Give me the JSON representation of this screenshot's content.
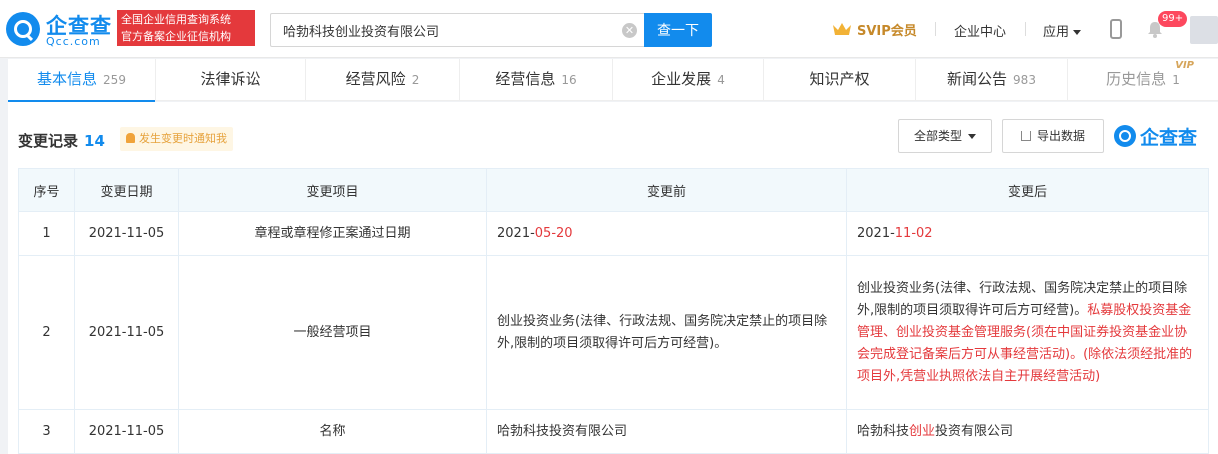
{
  "header": {
    "logo_cn": "企查查",
    "logo_en": "Qcc.com",
    "slogan_line1": "全国企业信用查询系统",
    "slogan_line2": "官方备案企业征信机构",
    "search_value": "哈勃科技创业投资有限公司",
    "search_button": "查一下",
    "svip_label": "SVIP会员",
    "enterprise_center": "企业中心",
    "apps_label": "应用",
    "notification_badge": "99+"
  },
  "tabs": [
    {
      "label": "基本信息",
      "count": "259"
    },
    {
      "label": "法律诉讼",
      "count": ""
    },
    {
      "label": "经营风险",
      "count": "2"
    },
    {
      "label": "经营信息",
      "count": "16"
    },
    {
      "label": "企业发展",
      "count": "4"
    },
    {
      "label": "知识产权",
      "count": ""
    },
    {
      "label": "新闻公告",
      "count": "983"
    },
    {
      "label": "历史信息",
      "count": "1",
      "tag": "VIP"
    }
  ],
  "section": {
    "title": "变更记录",
    "count": "14",
    "notify_label": "发生变更时通知我",
    "filter_label": "全部类型",
    "export_label": "导出数据",
    "brand_label": "企查查"
  },
  "table": {
    "headers": [
      "序号",
      "变更日期",
      "变更项目",
      "变更前",
      "变更后"
    ],
    "rows": [
      {
        "index": "1",
        "date": "2021-11-05",
        "item": "章程或章程修正案通过日期",
        "before_plain": "2021-",
        "before_hl": "05-20",
        "after_plain": "2021-",
        "after_hl": "11-02"
      },
      {
        "index": "2",
        "date": "2021-11-05",
        "item": "一般经营项目",
        "before": "创业投资业务(法律、行政法规、国务院决定禁止的项目除外,限制的项目须取得许可后方可经营)。",
        "after_plain": "创业投资业务(法律、行政法规、国务院决定禁止的项目除外,限制的项目须取得许可后方可经营)。",
        "after_hl": "私募股权投资基金管理、创业投资基金管理服务(须在中国证券投资基金业协会完成登记备案后方可从事经营活动)。(除依法须经批准的项目外,凭营业执照依法自主开展经营活动)"
      },
      {
        "index": "3",
        "date": "2021-11-05",
        "item": "名称",
        "before": "哈勃科技投资有限公司",
        "after_part1": "哈勃科技",
        "after_hl": "创业",
        "after_part2": "投资有限公司"
      }
    ]
  },
  "colors": {
    "accent": "#128bed",
    "highlight": "#e4393c",
    "vip_gold": "#c6892a"
  }
}
